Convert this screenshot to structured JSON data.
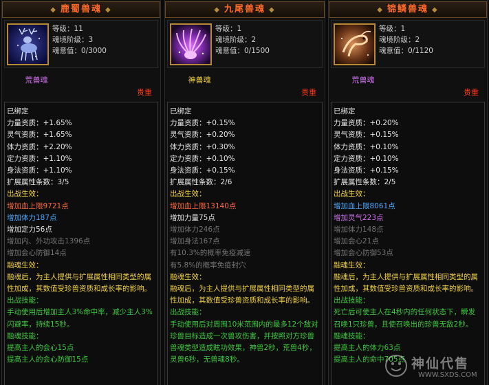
{
  "cards": [
    {
      "title": "鹿蜀兽魂",
      "level": "等级：11",
      "realm": "魂境阶级：3",
      "will": "魂意值：0/3000",
      "type": "荒兽魂",
      "type_color": "#d070f0",
      "rarity": "贵重",
      "bound": "已绑定",
      "attrs": [
        "力量资质：+1.65%",
        "灵气资质：+1.65%",
        "体力资质：+2.20%",
        "定力资质：+1.10%",
        "身法资质：+1.10%"
      ],
      "expand": "扩展属性条数：3/5",
      "battle_label": "出战生效：",
      "battle_effects": [
        {
          "text": "增加血上限9721点",
          "color": "red"
        },
        {
          "text": "增加体力187点",
          "color": "blue"
        },
        {
          "text": "增加定力56点",
          "color": "white"
        },
        {
          "text": "增加内、外功攻击1396点",
          "color": "gray"
        },
        {
          "text": "增加会心防御14点",
          "color": "gray"
        }
      ],
      "fusion_label": "融魂生效：",
      "fusion_text": "融魂后，为主人提供与扩展属性相同类型的属性加成，其数值受珍兽资质和成长率的影响。",
      "battle_skill_label": "出战技能：",
      "battle_skill_text": "手动使用后增加主人3%命中率，减少主人3%闪避率，持续15秒。",
      "fusion_skill_label": "融魂技能：",
      "fusion_skills": [
        "提高主人的会心15点",
        "提高主人的会心防御15点"
      ]
    },
    {
      "title": "九尾兽魂",
      "level": "等级：1",
      "realm": "魂境阶级：2",
      "will": "魂意值：0/1500",
      "type": "神兽魂",
      "type_color": "#f0d044",
      "rarity": "贵重",
      "bound": "已绑定",
      "attrs": [
        "力量资质：+0.15%",
        "灵气资质：+0.20%",
        "体力资质：+0.30%",
        "定力资质：+0.10%",
        "身法资质：+0.15%"
      ],
      "expand": "扩展属性条数：2/6",
      "battle_label": "出战生效：",
      "battle_effects": [
        {
          "text": "增加血上限13140点",
          "color": "red"
        },
        {
          "text": "增加力量75点",
          "color": "white"
        },
        {
          "text": "增加体力246点",
          "color": "gray"
        },
        {
          "text": "增加身法167点",
          "color": "gray"
        },
        {
          "text": "有10.3%的概率免疫减速",
          "color": "gray"
        },
        {
          "text": "有5.8%的概率免疫封穴",
          "color": "gray"
        }
      ],
      "fusion_label": "融魂生效：",
      "fusion_text": "融魂后，为主人提供与扩展属性相同类型的属性加成，其数值受珍兽资质和成长率的影响。",
      "battle_skill_label": "出战技能：",
      "battle_skill_text": "手动使用后对周围10米范围内的最多12个敌对珍兽目标造成一次兽攻伤害，并按照对方珍兽兽魂类型造成眩功效果，神兽2秒，荒兽4秒，灵兽6秒，无兽魂8秒。",
      "fusion_skill_label": "",
      "fusion_skills": []
    },
    {
      "title": "锦鳞兽魂",
      "level": "等级：1",
      "realm": "魂境阶级：2",
      "will": "魂意值：0/1120",
      "type": "荒兽魂",
      "type_color": "#d070f0",
      "rarity": "贵重",
      "bound": "已绑定",
      "attrs": [
        "力量资质：+0.20%",
        "灵气资质：+0.15%",
        "体力资质：+0.10%",
        "定力资质：+0.10%",
        "身法资质：+0.15%"
      ],
      "expand": "扩展属性条数：2/5",
      "battle_label": "出战生效：",
      "battle_effects": [
        {
          "text": "增加血上限8061点",
          "color": "blue"
        },
        {
          "text": "增加灵气223点",
          "color": "purple"
        },
        {
          "text": "增加体力148点",
          "color": "gray"
        },
        {
          "text": "增加会心21点",
          "color": "gray"
        },
        {
          "text": "增加会心防御53点",
          "color": "gray"
        }
      ],
      "fusion_label": "融魂生效：",
      "fusion_text": "融魂后，为主人提供与扩展属性相同类型的属性加成，其数值受珍兽资质和成长率的影响。",
      "battle_skill_label": "出战技能：",
      "battle_skill_text": "死亡后可使主人在4秒内的任何状态下，瞬发召唤1只珍兽，且使召唤出的珍兽无敌2秒。",
      "fusion_skill_label": "融魂技能：",
      "fusion_skills": [
        "提高主人的体力63点",
        "提高主人的命中705点"
      ]
    }
  ],
  "watermark": {
    "text": "神仙代售",
    "url": "WWW.SXDS.COM"
  }
}
